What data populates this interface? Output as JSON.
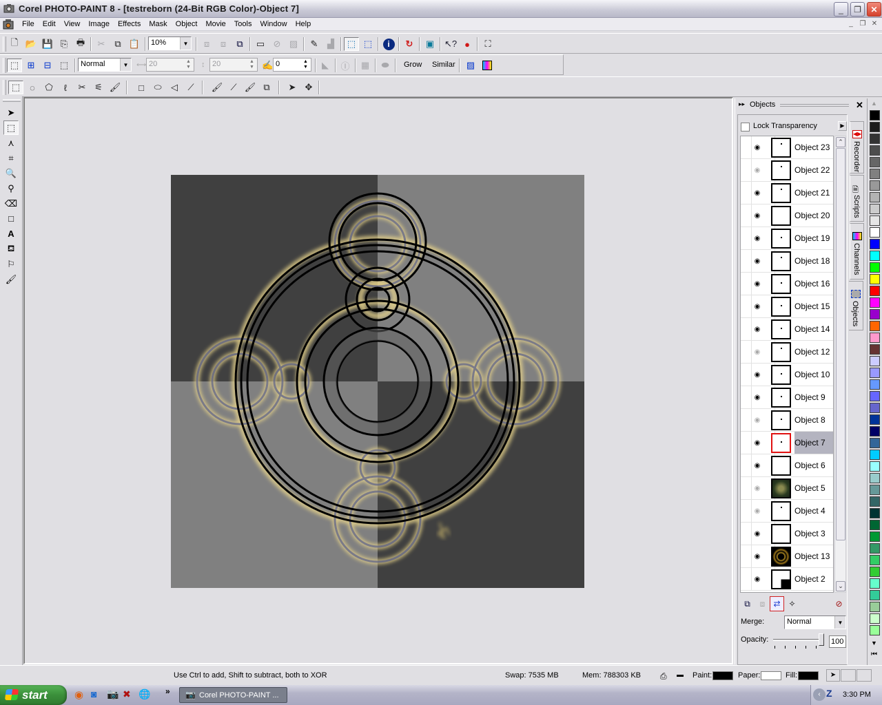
{
  "window": {
    "title": "Corel PHOTO-PAINT 8 - [testreborn  (24-Bit RGB Color)-Object 7]",
    "controls": [
      "minimize",
      "restore",
      "close"
    ]
  },
  "menu": {
    "items": [
      "File",
      "Edit",
      "View",
      "Image",
      "Effects",
      "Mask",
      "Object",
      "Movie",
      "Tools",
      "Window",
      "Help"
    ]
  },
  "toolbar_standard": {
    "zoom_value": "10%",
    "buttons": [
      "new",
      "open",
      "save",
      "export",
      "print",
      "cut",
      "copy",
      "paste",
      "combine",
      "combine-all",
      "create-object",
      "select-rect",
      "disabled-mask",
      "checker",
      "paint-on-mask",
      "invert",
      "rect-mask-1",
      "rect-mask-2",
      "info",
      "record",
      "screen",
      "whats-this",
      "apple",
      "full-screen"
    ]
  },
  "toolbar_mask": {
    "mode": "Normal",
    "width_value": "20",
    "height_value": "20",
    "feather_value": "0",
    "grow_label": "Grow",
    "similar_label": "Similar"
  },
  "toolbar_tools": {
    "buttons": [
      "rectangle-mask",
      "ellipse-mask",
      "freehand-mask",
      "lasso-mask",
      "scissors-mask",
      "magic-wand-mask",
      "brush-mask",
      "rectangle",
      "ellipse",
      "polygon",
      "line",
      "brush",
      "effect-brush",
      "clone-brush",
      "image-sprayer",
      "pick",
      "move"
    ]
  },
  "toolbox": {
    "tools": [
      "object-picker",
      "mask-tool",
      "mask-transform",
      "crop",
      "zoom",
      "eyedropper",
      "eraser",
      "rectangle",
      "text",
      "fill",
      "path",
      "brush"
    ]
  },
  "canvas": {
    "quadrant_colors": {
      "dark": "#404040",
      "light": "#808080"
    },
    "glow_color": "#e8d48a"
  },
  "objects_docker": {
    "title": "Objects",
    "lock_transparency_label": "Lock Transparency",
    "lock_transparency_checked": false,
    "objects": [
      {
        "name": "Object 23",
        "visible": true,
        "selected": false,
        "thumb": "dot"
      },
      {
        "name": "Object 22",
        "visible": false,
        "selected": false,
        "thumb": "dot"
      },
      {
        "name": "Object 21",
        "visible": true,
        "selected": false,
        "thumb": "dot"
      },
      {
        "name": "Object 20",
        "visible": true,
        "selected": false,
        "thumb": "blank"
      },
      {
        "name": "Object 19",
        "visible": true,
        "selected": false,
        "thumb": "dots"
      },
      {
        "name": "Object 18",
        "visible": true,
        "selected": false,
        "thumb": "dot"
      },
      {
        "name": "Object 16",
        "visible": true,
        "selected": false,
        "thumb": "dots"
      },
      {
        "name": "Object 15",
        "visible": true,
        "selected": false,
        "thumb": "dots"
      },
      {
        "name": "Object 14",
        "visible": true,
        "selected": false,
        "thumb": "dots"
      },
      {
        "name": "Object 12",
        "visible": false,
        "selected": false,
        "thumb": "dot"
      },
      {
        "name": "Object 10",
        "visible": true,
        "selected": false,
        "thumb": "dots"
      },
      {
        "name": "Object 9",
        "visible": true,
        "selected": false,
        "thumb": "dots"
      },
      {
        "name": "Object 8",
        "visible": false,
        "selected": false,
        "thumb": "dots"
      },
      {
        "name": "Object 7",
        "visible": true,
        "selected": true,
        "thumb": "dots"
      },
      {
        "name": "Object 6",
        "visible": true,
        "selected": false,
        "thumb": "blank"
      },
      {
        "name": "Object 5",
        "visible": false,
        "selected": false,
        "thumb": "image-green"
      },
      {
        "name": "Object 4",
        "visible": false,
        "selected": false,
        "thumb": "dot"
      },
      {
        "name": "Object 3",
        "visible": true,
        "selected": false,
        "thumb": "blank"
      },
      {
        "name": "Object 13",
        "visible": true,
        "selected": false,
        "thumb": "image-gold"
      },
      {
        "name": "Object 2",
        "visible": true,
        "selected": false,
        "thumb": "corner"
      }
    ],
    "merge_label": "Merge:",
    "merge_value": "Normal",
    "opacity_label": "Opacity:",
    "opacity_value": "100"
  },
  "side_tabs": [
    "Recorder",
    "Scripts",
    "Channels",
    "Objects"
  ],
  "palette": [
    "#000000",
    "#1c1c1c",
    "#333333",
    "#4d4d4d",
    "#666666",
    "#808080",
    "#999999",
    "#b3b3b3",
    "#cccccc",
    "#e6e6e6",
    "#ffffff",
    "#0000ff",
    "#00ffff",
    "#00ff00",
    "#ffff00",
    "#ff0000",
    "#ff00ff",
    "#9900cc",
    "#ff6600",
    "#ff99cc",
    "#663333",
    "#ccccff",
    "#9999ff",
    "#6699ff",
    "#6666ff",
    "#6666cc",
    "#003399",
    "#000066",
    "#336699",
    "#00ccff",
    "#99ffff",
    "#99cccc",
    "#669999",
    "#336666",
    "#003333",
    "#006633",
    "#009933",
    "#339966",
    "#33cc66",
    "#33cc33",
    "#66ffcc",
    "#33cc99",
    "#99cc99",
    "#ccffcc",
    "#99ff99"
  ],
  "status": {
    "hint": "Use Ctrl to add, Shift to subtract, both to XOR",
    "swap": "Swap: 7535 MB",
    "mem": "Mem: 788303 KB",
    "paint_label": "Paint:",
    "paper_label": "Paper:",
    "fill_label": "Fill:",
    "paint_color": "#000000",
    "paper_color": "#ffffff",
    "fill_color": "#000000"
  },
  "taskbar": {
    "start_label": "start",
    "task_label": "Corel PHOTO-PAINT ...",
    "overflow": "»",
    "clock": "3:30 PM"
  }
}
